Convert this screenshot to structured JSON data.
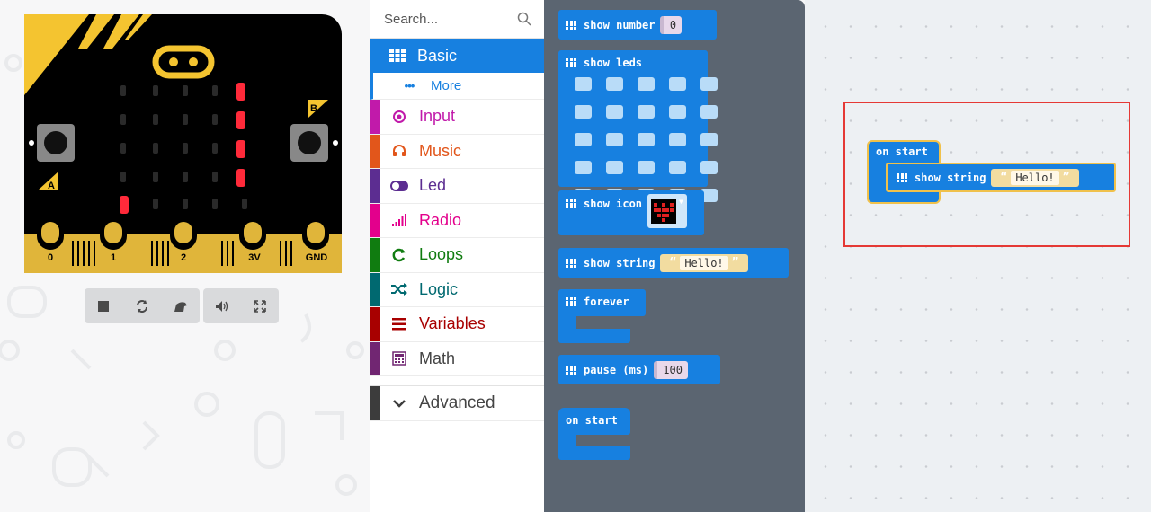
{
  "simulator": {
    "pins": [
      "0",
      "1",
      "2",
      "3V",
      "GND"
    ],
    "button_a": "A",
    "button_b": "B",
    "toolbar": [
      "stop-icon",
      "restart-icon",
      "debug-icon",
      "sound-icon",
      "fullscreen-icon"
    ]
  },
  "categories": {
    "search_placeholder": "Search...",
    "items": [
      {
        "label": "Basic",
        "icon": "grid-icon",
        "color": "#1780e0"
      },
      {
        "label": "More",
        "icon": "more-icon",
        "color": "#1780e0"
      },
      {
        "label": "Input",
        "icon": "target-icon",
        "color": "#c11aaa"
      },
      {
        "label": "Music",
        "icon": "headphones-icon",
        "color": "#e2561b"
      },
      {
        "label": "Led",
        "icon": "toggle-icon",
        "color": "#5c2d91"
      },
      {
        "label": "Radio",
        "icon": "signal-icon",
        "color": "#e3008c"
      },
      {
        "label": "Loops",
        "icon": "refresh-icon",
        "color": "#107c10"
      },
      {
        "label": "Logic",
        "icon": "shuffle-icon",
        "color": "#006970"
      },
      {
        "label": "Variables",
        "icon": "list-icon",
        "color": "#a80000"
      },
      {
        "label": "Math",
        "icon": "calculator-icon",
        "color": "#712672"
      },
      {
        "label": "Advanced",
        "icon": "chevron-down-icon",
        "color": "#3c3c3c"
      }
    ]
  },
  "flyout": {
    "show_number": {
      "label": "show number",
      "value": "0"
    },
    "show_leds": {
      "label": "show leds"
    },
    "show_icon": {
      "label": "show icon"
    },
    "show_string": {
      "label": "show string",
      "value": "Hello!"
    },
    "forever": {
      "label": "forever"
    },
    "pause": {
      "label": "pause (ms)",
      "value": "100"
    },
    "on_start": {
      "label": "on start"
    }
  },
  "workspace": {
    "on_start_label": "on start",
    "show_string_label": "show string",
    "show_string_value": "Hello!"
  }
}
